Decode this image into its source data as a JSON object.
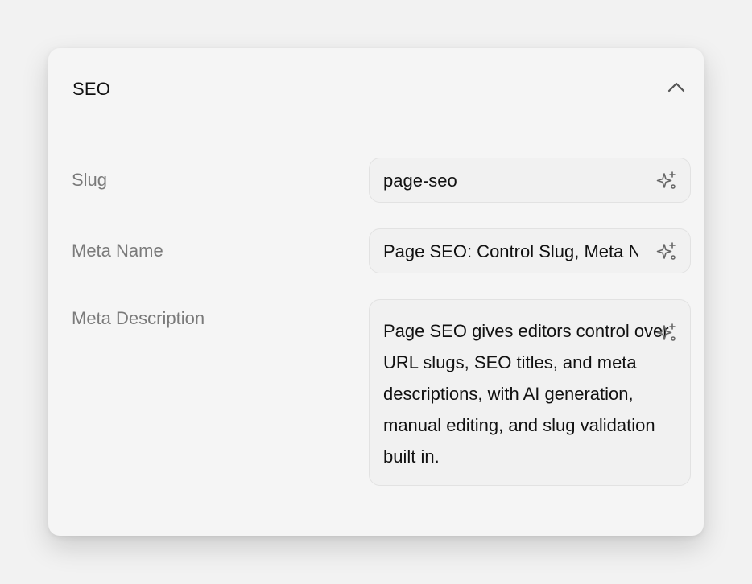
{
  "section": {
    "title": "SEO"
  },
  "fields": {
    "slug": {
      "label": "Slug",
      "value": "page-seo"
    },
    "meta_name": {
      "label": "Meta Name",
      "value": "Page SEO: Control Slug, Meta Name & Description"
    },
    "meta_description": {
      "label": "Meta Description",
      "value": "Page SEO gives editors control over URL slugs, SEO titles, and meta descriptions, with AI generation, manual editing, and slug validation built in."
    }
  },
  "icons": {
    "collapse": "chevron-up-icon",
    "ai_generate": "sparkles-icon"
  }
}
